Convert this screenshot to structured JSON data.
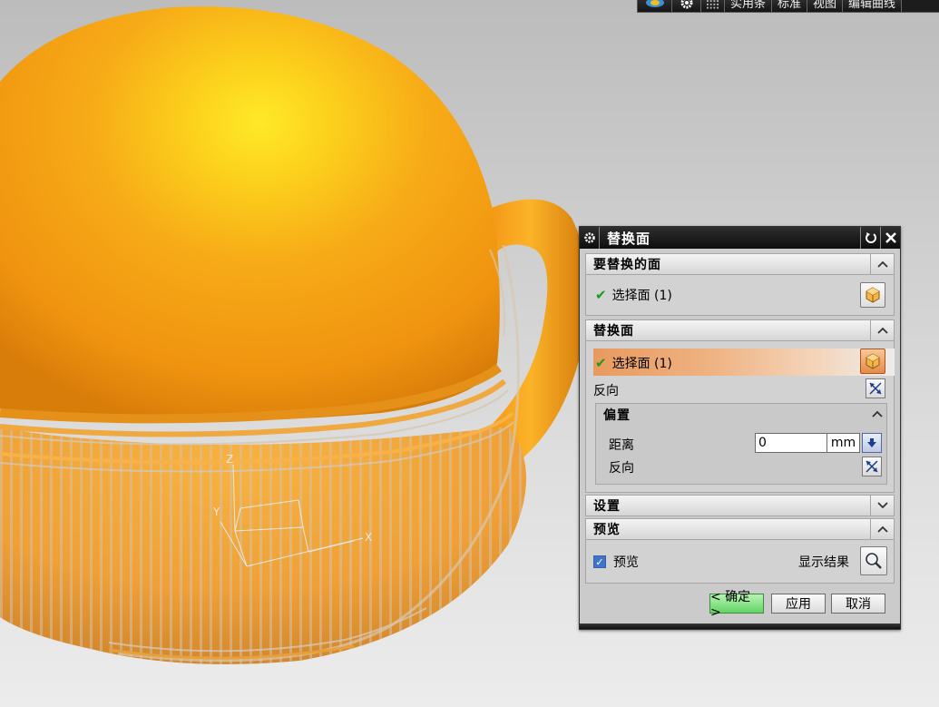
{
  "toolbar": {
    "items": [
      "",
      "",
      "",
      "实用条",
      "标准",
      "视图",
      "编辑曲线"
    ]
  },
  "dialog": {
    "title": "替换面",
    "sections": {
      "faces_to_replace": {
        "header": "要替换的面",
        "select_label": "选择面 (1)"
      },
      "replacement_face": {
        "header": "替换面",
        "select_label": "选择面 (1)",
        "reverse_label": "反向",
        "offset": {
          "header": "偏置",
          "distance_label": "距离",
          "distance_value": "0",
          "unit": "mm",
          "reverse_label": "反向"
        }
      },
      "settings": {
        "header": "设置"
      },
      "preview": {
        "header": "预览",
        "checkbox_label": "预览",
        "checked": true,
        "show_result_label": "显示结果"
      }
    },
    "buttons": {
      "ok": "< 确定 >",
      "apply": "应用",
      "cancel": "取消"
    }
  },
  "axes": {
    "x": "X",
    "y": "Y",
    "z": "Z"
  },
  "colors": {
    "model_orange": "#f7a21a",
    "highlight": "#e89a5e",
    "check_green": "#1a9b1a"
  }
}
